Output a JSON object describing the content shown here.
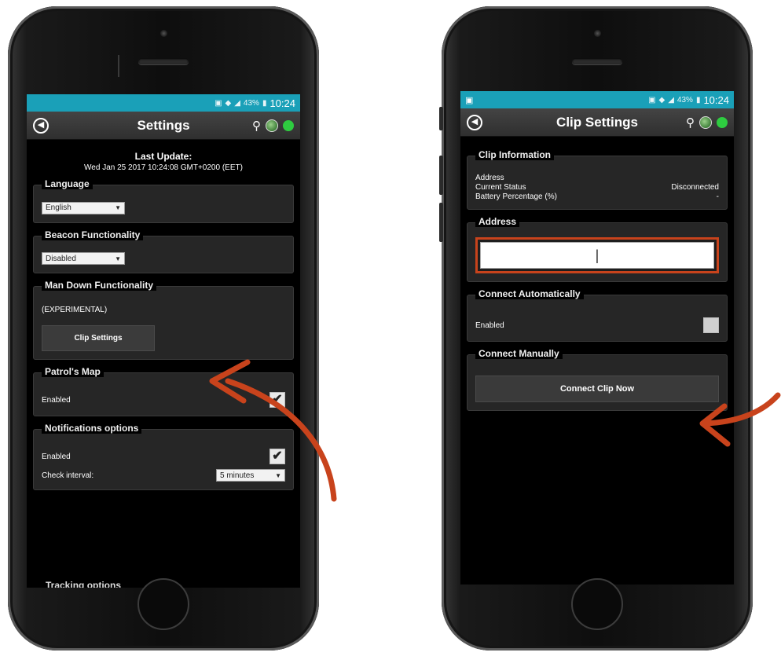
{
  "left_phone": {
    "status": {
      "time": "10:24",
      "battery": "43%"
    },
    "action_bar": {
      "title": "Settings"
    },
    "last_update": {
      "title": "Last Update:",
      "date": "Wed Jan 25 2017 10:24:08 GMT+0200 (EET)"
    },
    "language": {
      "title": "Language",
      "value": "English"
    },
    "beacon": {
      "title": "Beacon Functionality",
      "value": "Disabled"
    },
    "man_down": {
      "title": "Man Down Functionality",
      "note": "(EXPERIMENTAL)",
      "button": "Clip Settings"
    },
    "patrols_map": {
      "title": "Patrol's Map",
      "label": "Enabled",
      "checked": true
    },
    "notifications": {
      "title": "Notifications options",
      "label": "Enabled",
      "checked": true,
      "interval_label": "Check interval:",
      "interval_value": "5 minutes"
    },
    "tracking": {
      "title": "Tracking options"
    }
  },
  "right_phone": {
    "status": {
      "time": "10:24",
      "battery": "43%"
    },
    "action_bar": {
      "title": "Clip Settings"
    },
    "clip_info": {
      "title": "Clip Information",
      "rows": [
        {
          "label": "Address",
          "value": ""
        },
        {
          "label": "Current Status",
          "value": "Disconnected"
        },
        {
          "label": "Battery Percentage (%)",
          "value": "-"
        }
      ]
    },
    "address": {
      "title": "Address",
      "value": "|"
    },
    "connect_auto": {
      "title": "Connect Automatically",
      "label": "Enabled",
      "checked": false
    },
    "connect_manual": {
      "title": "Connect Manually",
      "button": "Connect Clip Now"
    }
  },
  "colors": {
    "accent_arrow": "#c8431c",
    "status_bar": "#1aa0b8",
    "online_dot": "#2ecc40"
  }
}
